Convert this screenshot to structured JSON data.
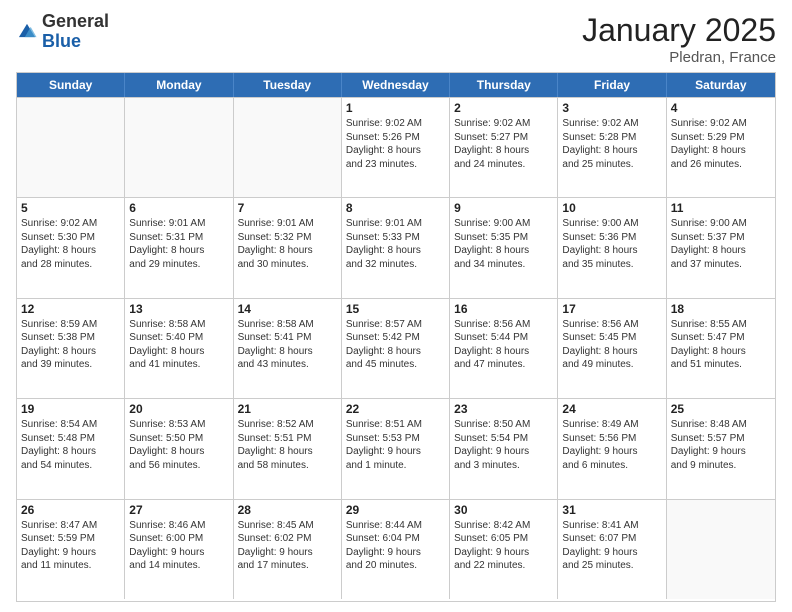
{
  "logo": {
    "general": "General",
    "blue": "Blue"
  },
  "title": "January 2025",
  "location": "Pledran, France",
  "days": [
    "Sunday",
    "Monday",
    "Tuesday",
    "Wednesday",
    "Thursday",
    "Friday",
    "Saturday"
  ],
  "rows": [
    [
      {
        "day": "",
        "lines": []
      },
      {
        "day": "",
        "lines": []
      },
      {
        "day": "",
        "lines": []
      },
      {
        "day": "1",
        "lines": [
          "Sunrise: 9:02 AM",
          "Sunset: 5:26 PM",
          "Daylight: 8 hours",
          "and 23 minutes."
        ]
      },
      {
        "day": "2",
        "lines": [
          "Sunrise: 9:02 AM",
          "Sunset: 5:27 PM",
          "Daylight: 8 hours",
          "and 24 minutes."
        ]
      },
      {
        "day": "3",
        "lines": [
          "Sunrise: 9:02 AM",
          "Sunset: 5:28 PM",
          "Daylight: 8 hours",
          "and 25 minutes."
        ]
      },
      {
        "day": "4",
        "lines": [
          "Sunrise: 9:02 AM",
          "Sunset: 5:29 PM",
          "Daylight: 8 hours",
          "and 26 minutes."
        ]
      }
    ],
    [
      {
        "day": "5",
        "lines": [
          "Sunrise: 9:02 AM",
          "Sunset: 5:30 PM",
          "Daylight: 8 hours",
          "and 28 minutes."
        ]
      },
      {
        "day": "6",
        "lines": [
          "Sunrise: 9:01 AM",
          "Sunset: 5:31 PM",
          "Daylight: 8 hours",
          "and 29 minutes."
        ]
      },
      {
        "day": "7",
        "lines": [
          "Sunrise: 9:01 AM",
          "Sunset: 5:32 PM",
          "Daylight: 8 hours",
          "and 30 minutes."
        ]
      },
      {
        "day": "8",
        "lines": [
          "Sunrise: 9:01 AM",
          "Sunset: 5:33 PM",
          "Daylight: 8 hours",
          "and 32 minutes."
        ]
      },
      {
        "day": "9",
        "lines": [
          "Sunrise: 9:00 AM",
          "Sunset: 5:35 PM",
          "Daylight: 8 hours",
          "and 34 minutes."
        ]
      },
      {
        "day": "10",
        "lines": [
          "Sunrise: 9:00 AM",
          "Sunset: 5:36 PM",
          "Daylight: 8 hours",
          "and 35 minutes."
        ]
      },
      {
        "day": "11",
        "lines": [
          "Sunrise: 9:00 AM",
          "Sunset: 5:37 PM",
          "Daylight: 8 hours",
          "and 37 minutes."
        ]
      }
    ],
    [
      {
        "day": "12",
        "lines": [
          "Sunrise: 8:59 AM",
          "Sunset: 5:38 PM",
          "Daylight: 8 hours",
          "and 39 minutes."
        ]
      },
      {
        "day": "13",
        "lines": [
          "Sunrise: 8:58 AM",
          "Sunset: 5:40 PM",
          "Daylight: 8 hours",
          "and 41 minutes."
        ]
      },
      {
        "day": "14",
        "lines": [
          "Sunrise: 8:58 AM",
          "Sunset: 5:41 PM",
          "Daylight: 8 hours",
          "and 43 minutes."
        ]
      },
      {
        "day": "15",
        "lines": [
          "Sunrise: 8:57 AM",
          "Sunset: 5:42 PM",
          "Daylight: 8 hours",
          "and 45 minutes."
        ]
      },
      {
        "day": "16",
        "lines": [
          "Sunrise: 8:56 AM",
          "Sunset: 5:44 PM",
          "Daylight: 8 hours",
          "and 47 minutes."
        ]
      },
      {
        "day": "17",
        "lines": [
          "Sunrise: 8:56 AM",
          "Sunset: 5:45 PM",
          "Daylight: 8 hours",
          "and 49 minutes."
        ]
      },
      {
        "day": "18",
        "lines": [
          "Sunrise: 8:55 AM",
          "Sunset: 5:47 PM",
          "Daylight: 8 hours",
          "and 51 minutes."
        ]
      }
    ],
    [
      {
        "day": "19",
        "lines": [
          "Sunrise: 8:54 AM",
          "Sunset: 5:48 PM",
          "Daylight: 8 hours",
          "and 54 minutes."
        ]
      },
      {
        "day": "20",
        "lines": [
          "Sunrise: 8:53 AM",
          "Sunset: 5:50 PM",
          "Daylight: 8 hours",
          "and 56 minutes."
        ]
      },
      {
        "day": "21",
        "lines": [
          "Sunrise: 8:52 AM",
          "Sunset: 5:51 PM",
          "Daylight: 8 hours",
          "and 58 minutes."
        ]
      },
      {
        "day": "22",
        "lines": [
          "Sunrise: 8:51 AM",
          "Sunset: 5:53 PM",
          "Daylight: 9 hours",
          "and 1 minute."
        ]
      },
      {
        "day": "23",
        "lines": [
          "Sunrise: 8:50 AM",
          "Sunset: 5:54 PM",
          "Daylight: 9 hours",
          "and 3 minutes."
        ]
      },
      {
        "day": "24",
        "lines": [
          "Sunrise: 8:49 AM",
          "Sunset: 5:56 PM",
          "Daylight: 9 hours",
          "and 6 minutes."
        ]
      },
      {
        "day": "25",
        "lines": [
          "Sunrise: 8:48 AM",
          "Sunset: 5:57 PM",
          "Daylight: 9 hours",
          "and 9 minutes."
        ]
      }
    ],
    [
      {
        "day": "26",
        "lines": [
          "Sunrise: 8:47 AM",
          "Sunset: 5:59 PM",
          "Daylight: 9 hours",
          "and 11 minutes."
        ]
      },
      {
        "day": "27",
        "lines": [
          "Sunrise: 8:46 AM",
          "Sunset: 6:00 PM",
          "Daylight: 9 hours",
          "and 14 minutes."
        ]
      },
      {
        "day": "28",
        "lines": [
          "Sunrise: 8:45 AM",
          "Sunset: 6:02 PM",
          "Daylight: 9 hours",
          "and 17 minutes."
        ]
      },
      {
        "day": "29",
        "lines": [
          "Sunrise: 8:44 AM",
          "Sunset: 6:04 PM",
          "Daylight: 9 hours",
          "and 20 minutes."
        ]
      },
      {
        "day": "30",
        "lines": [
          "Sunrise: 8:42 AM",
          "Sunset: 6:05 PM",
          "Daylight: 9 hours",
          "and 22 minutes."
        ]
      },
      {
        "day": "31",
        "lines": [
          "Sunrise: 8:41 AM",
          "Sunset: 6:07 PM",
          "Daylight: 9 hours",
          "and 25 minutes."
        ]
      },
      {
        "day": "",
        "lines": []
      }
    ]
  ]
}
